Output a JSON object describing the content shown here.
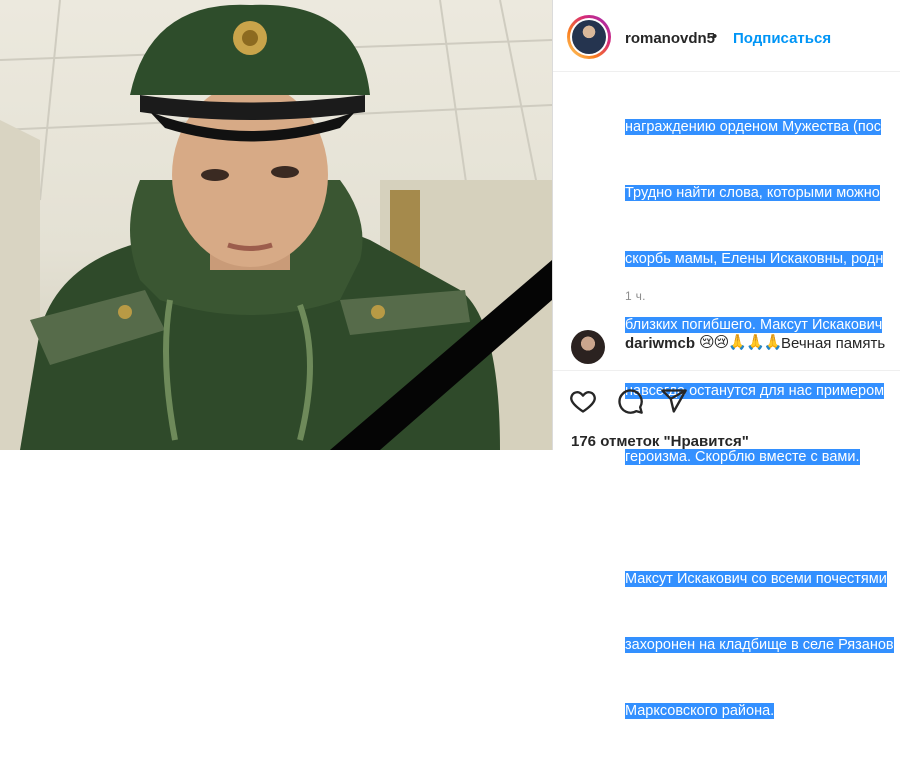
{
  "post": {
    "username": "romanovdn5",
    "separator": "•",
    "follow_label": "Подписаться",
    "caption_lines": [
      "награждению орденом Мужества (пос",
      "Трудно найти слова, которыми можно",
      "скорбь мамы, Елены Искаковны, родн",
      "близких погибшего. Максут Искакович",
      "навсегда останутся для нас примером",
      "героизма. Скорблю вместе с вами."
    ],
    "caption_lines_2": [
      "Максут Искакович со всеми почестями",
      "захоронен на кладбище в селе Рязанов",
      "Марксовского района."
    ],
    "timestamp": "1 ч.",
    "likes_text": "176 отметок \"Нравится\""
  },
  "comment": {
    "username": "dariwmcb",
    "emojis": "😢😢🙏🙏🙏",
    "text": "Вечная память"
  },
  "colors": {
    "selection": "#3390ff",
    "follow": "#0095f6",
    "text": "#262626",
    "muted": "#8e8e8e"
  },
  "icons": [
    "heart-icon",
    "comment-icon",
    "share-icon"
  ]
}
